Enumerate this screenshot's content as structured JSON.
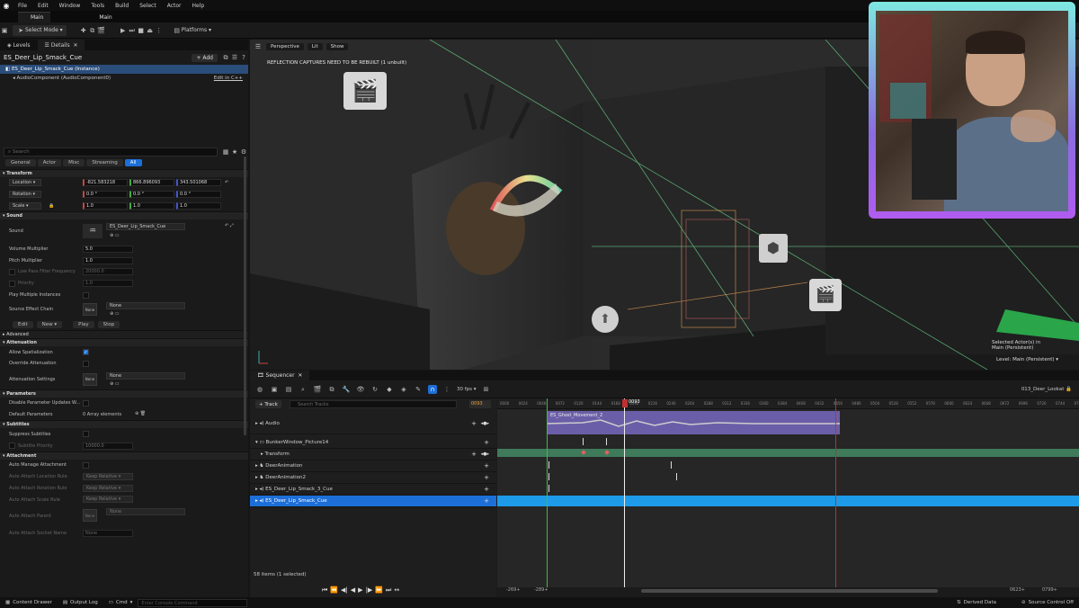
{
  "menu": {
    "items": [
      "File",
      "Edit",
      "Window",
      "Tools",
      "Build",
      "Select",
      "Actor",
      "Help"
    ]
  },
  "tabs": [
    {
      "label": "Main"
    },
    {
      "label": "Main"
    }
  ],
  "toolbar": {
    "select_mode": "Select Mode",
    "platforms": "Platforms"
  },
  "left_panel": {
    "tabs": [
      "Levels",
      "Details"
    ],
    "object_title": "ES_Deer_Lip_Smack_Cue",
    "add_label": "Add",
    "tree": [
      {
        "label": "ES_Deer_Lip_Smack_Cue (Instance)"
      },
      {
        "label": "AudioComponent (AudioComponent0)",
        "extra": "Edit in C++"
      }
    ],
    "search_placeholder": "Search",
    "filters": [
      "General",
      "Actor",
      "Misc",
      "Streaming",
      "All"
    ],
    "sections": {
      "transform": "Transform",
      "sound": "Sound",
      "advanced": "Advanced",
      "attenuation": "Attenuation",
      "parameters": "Parameters",
      "subtitles": "Subtitles",
      "attachment": "Attachment"
    },
    "transform": {
      "location_label": "Location",
      "location": [
        "-821.583218",
        "866.896093",
        "343.501068"
      ],
      "rotation_label": "Rotation",
      "rotation": [
        "0.0 °",
        "0.0 °",
        "0.0 °"
      ],
      "scale_label": "Scale",
      "scale": [
        "1.0",
        "1.0",
        "1.0"
      ]
    },
    "sound": {
      "sound_label": "Sound",
      "sound_value": "ES_Deer_Lip_Smack_Cue",
      "volume_label": "Volume Multiplier",
      "volume": "5.0",
      "pitch_label": "Pitch Multiplier",
      "pitch": "1.0",
      "lowpass_label": "Low Pass Filter Frequency",
      "lowpass": "20000.0",
      "priority_label": "Priority",
      "priority": "1.0",
      "multi_label": "Play Multiple Instances",
      "source_chain_label": "Source Effect Chain",
      "source_chain": "None",
      "thumb": "None",
      "edit": "Edit",
      "new": "New",
      "play": "Play",
      "stop": "Stop"
    },
    "attenuation": {
      "allow_label": "Allow Spatialization",
      "override_label": "Override Attenuation",
      "settings_label": "Attenuation Settings",
      "settings": "None",
      "thumb": "None"
    },
    "parameters": {
      "disable_label": "Disable Parameter Updates W...",
      "default_label": "Default Parameters",
      "default_value": "0 Array elements"
    },
    "subtitles": {
      "suppress_label": "Suppress Subtitles",
      "priority_label": "Subtitle Priority",
      "priority": "10000.0"
    },
    "attachment": {
      "manage_label": "Auto Manage Attachment",
      "loc_label": "Auto Attach Location Rule",
      "loc": "Keep Relative",
      "rot_label": "Auto Attach Rotation Rule",
      "rot": "Keep Relative",
      "scale_label": "Auto Attach Scale Rule",
      "scale": "Keep Relative",
      "parent_label": "Auto Attach Parent",
      "parent": "None",
      "parent_thumb": "None",
      "socket_label": "Auto Attach Socket Name",
      "socket": "None"
    }
  },
  "viewport": {
    "perspective": "Perspective",
    "lit": "Lit",
    "show": "Show",
    "warning": "REFLECTION CAPTURES NEED TO BE REBUILT (1 unbuilt)",
    "selected": "Selected Actor(s) in",
    "selected_level": "Main (Persistent)",
    "level": "Level: Main (Persistent)"
  },
  "sequencer": {
    "tab": "Sequencer",
    "fps": "30 fps",
    "sequence_name": "013_Deer_Lookat",
    "track_btn": "Track",
    "search_placeholder": "Search Tracks",
    "current_frame": "0093",
    "playhead_label": "0093",
    "tracks": [
      {
        "label": "Audio"
      },
      {
        "label": "BunkerWindow_Picture14"
      },
      {
        "label": "Transform"
      },
      {
        "label": "DeerAnimation"
      },
      {
        "label": "DeerAnimation2"
      },
      {
        "label": "ES_Deer_Lip_Smack_3_Cue"
      },
      {
        "label": "ES_Deer_Lip_Smack_Cue"
      }
    ],
    "audio_clip": "ES_Ghost_Movement_2",
    "ruler_ticks": [
      "0000",
      "0024",
      "0048",
      "0072",
      "0120",
      "0144",
      "0168",
      "0192",
      "0216",
      "0240",
      "0264",
      "0288",
      "0312",
      "0336",
      "0360",
      "0384",
      "0408",
      "0432",
      "0456",
      "0480",
      "0504",
      "0528",
      "0552",
      "0576",
      "0600",
      "0624",
      "0648",
      "0672",
      "0696",
      "0720",
      "0744",
      "0768"
    ],
    "items_count": "58 items (1 selected)",
    "range_start": "-269+",
    "range_start2": "-289+",
    "range_end": "0623+",
    "range_end2": "0799+"
  },
  "status": {
    "content_drawer": "Content Drawer",
    "output_log": "Output Log",
    "cmd": "Cmd",
    "console_placeholder": "Enter Console Command",
    "derived": "Derived Data",
    "source_control": "Source Control Off"
  }
}
